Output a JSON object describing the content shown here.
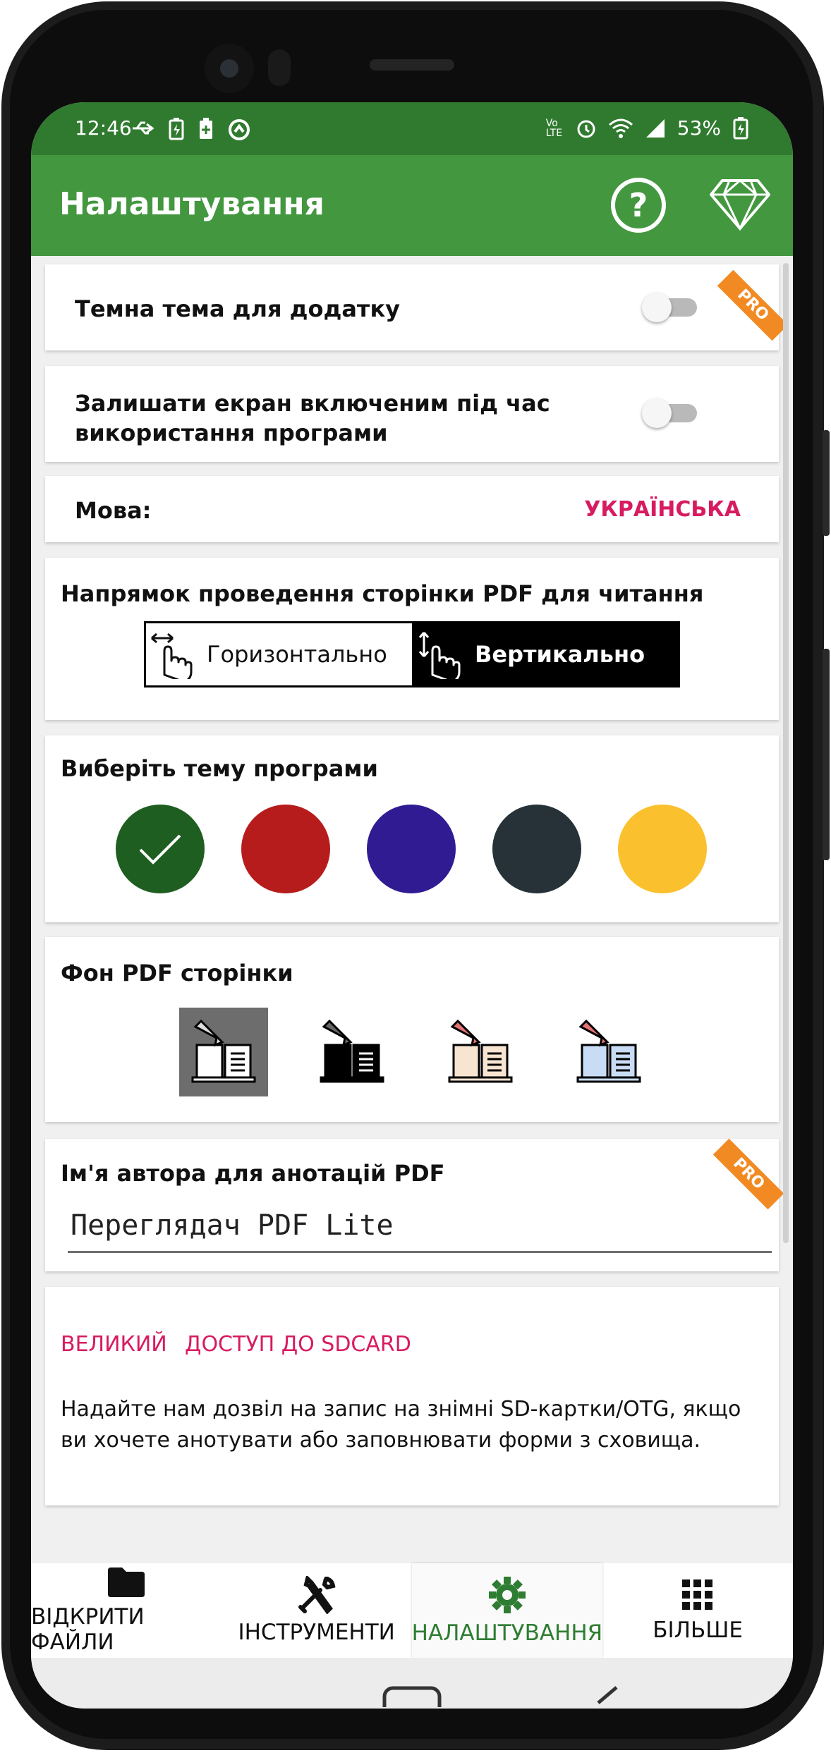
{
  "status": {
    "time": "12:46",
    "battery_pct": "53%",
    "volte": "Vo LTE"
  },
  "appbar": {
    "title": "Налаштування",
    "help_icon": "?"
  },
  "settings": {
    "dark_theme_label": "Темна тема для додатку",
    "pro_badge": "PRO",
    "keep_screen_label": "Залишати екран включеним під час використання програми",
    "language_label": "Мова:",
    "language_value": "УКРАЇНСЬКА",
    "scroll_direction_title": "Напрямок проведення сторінки PDF для читання",
    "scroll_horizontal": "Горизонтально",
    "scroll_vertical": "Вертикально",
    "theme_title": "Виберіть тему програми",
    "theme_colors": [
      "#1e5e20",
      "#b71c1c",
      "#311b92",
      "#263238",
      "#fbc02d"
    ],
    "pdf_bg_title": "Фон PDF сторінки",
    "pdf_bg_colors": [
      "#ffffff",
      "#000000",
      "#f7e5d2",
      "#c9dcf5"
    ],
    "author_title": "Ім'я автора для анотацій PDF",
    "author_value": "Переглядач PDF Lite",
    "sd_big": "ВЕЛИКИЙ",
    "sd_access": "ДОСТУП ДО SDCARD",
    "sd_desc": "Надайте нам дозвіл на запис на знімні SD-картки/OTG, якщо ви хочете анотувати або заповнювати форми з сховища."
  },
  "nav": {
    "open_files": "ВІДКРИТИ ФАЙЛИ",
    "tools": "ІНСТРУМЕНТИ",
    "settings": "НАЛАШТУВАННЯ",
    "more": "БІЛЬШЕ"
  },
  "colors": {
    "primary": "#43973f",
    "status": "#307a2f",
    "accent": "#d81b60",
    "pro": "#f28a23"
  }
}
